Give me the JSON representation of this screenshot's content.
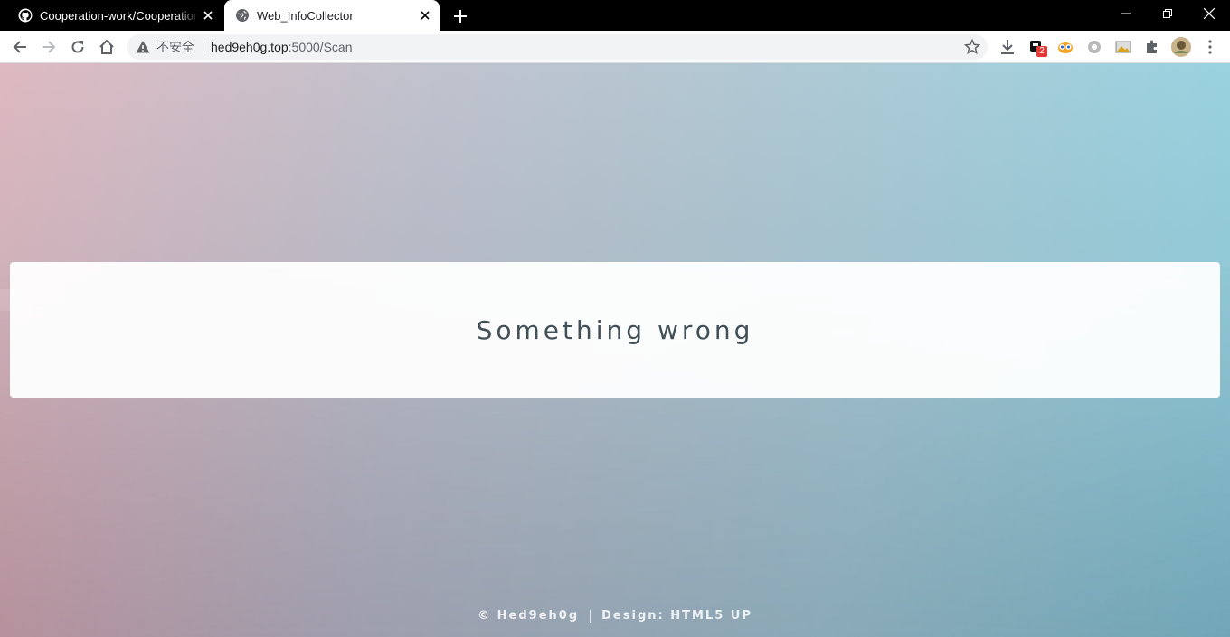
{
  "tabs": [
    {
      "title": "Cooperation-work/Cooperation-work",
      "favicon": "github-icon",
      "active": false
    },
    {
      "title": "Web_InfoCollector",
      "favicon": "globe-icon",
      "active": true
    }
  ],
  "omnibox": {
    "security_label": "不安全",
    "host": "hed9eh0g.top",
    "path": ":5000/Scan"
  },
  "extensions": {
    "badge_count": "2"
  },
  "page": {
    "message": "Something wrong",
    "footer_copyright": "© Hed9eh0g",
    "footer_design": "Design: HTML5 UP"
  },
  "colors": {
    "gradient_left": "#deb9c1",
    "gradient_right": "#95d4e2",
    "badge": "#e53935"
  }
}
